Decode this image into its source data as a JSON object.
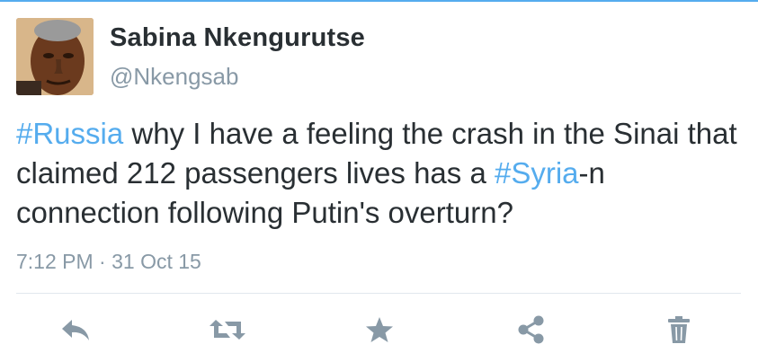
{
  "user": {
    "name": "Sabina Nkengurutse",
    "handle": "@Nkengsab",
    "avatar_icon": "profile-photo"
  },
  "tweet": {
    "hashtag_russia": "#Russia",
    "text_1": " why I have a feeling the crash in the Sinai that claimed 212 passengers lives has a ",
    "hashtag_syria": "#Syria",
    "text_2": "-n connection following Putin's overturn?",
    "time": "7:12 PM",
    "separator": " · ",
    "date": "31 Oct 15"
  },
  "actions": [
    {
      "name": "reply",
      "icon": "reply-icon"
    },
    {
      "name": "retweet",
      "icon": "retweet-icon"
    },
    {
      "name": "favorite",
      "icon": "star-icon"
    },
    {
      "name": "share",
      "icon": "share-icon"
    },
    {
      "name": "delete",
      "icon": "trash-icon"
    }
  ],
  "colors": {
    "accent": "#55acee",
    "text": "#292f33",
    "muted": "#8899a6",
    "icon": "#8899a6"
  }
}
